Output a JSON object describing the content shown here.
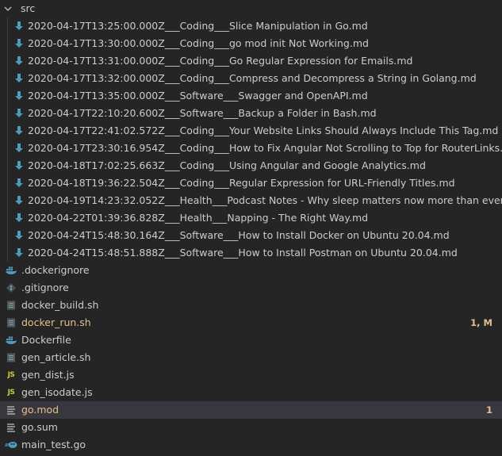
{
  "explorer": {
    "folder": {
      "name": "src",
      "expanded": true,
      "icon": "chevron-down-icon",
      "files": [
        {
          "name": "2020-04-17T13:25:00.000Z___Coding___Slice Manipulation in Go.md",
          "icon": "markdown-download-icon"
        },
        {
          "name": "2020-04-17T13:30:00.000Z___Coding___go mod init Not Working.md",
          "icon": "markdown-download-icon"
        },
        {
          "name": "2020-04-17T13:31:00.000Z___Coding___Go Regular Expression for Emails.md",
          "icon": "markdown-download-icon"
        },
        {
          "name": "2020-04-17T13:32:00.000Z___Coding___Compress and Decompress a String in Golang.md",
          "icon": "markdown-download-icon"
        },
        {
          "name": "2020-04-17T13:35:00.000Z___Software___Swagger and OpenAPI.md",
          "icon": "markdown-download-icon"
        },
        {
          "name": "2020-04-17T22:10:20.600Z___Software___Backup a Folder in Bash.md",
          "icon": "markdown-download-icon"
        },
        {
          "name": "2020-04-17T22:41:02.572Z___Coding___Your Website Links Should Always Include This Tag.md",
          "icon": "markdown-download-icon"
        },
        {
          "name": "2020-04-17T23:30:16.954Z___Coding___How to Fix Angular Not Scrolling to Top for RouterLinks.md",
          "icon": "markdown-download-icon"
        },
        {
          "name": "2020-04-18T17:02:25.663Z___Coding___Using Angular and Google Analytics.md",
          "icon": "markdown-download-icon"
        },
        {
          "name": "2020-04-18T19:36:22.504Z___Coding___Regular Expression for URL-Friendly Titles.md",
          "icon": "markdown-download-icon"
        },
        {
          "name": "2020-04-19T14:23:32.052Z___Health___Podcast Notes - Why sleep matters now more than ever.md",
          "icon": "markdown-download-icon"
        },
        {
          "name": "2020-04-22T01:39:36.828Z___Health___Napping - The Right Way.md",
          "icon": "markdown-download-icon"
        },
        {
          "name": "2020-04-24T15:48:30.164Z___Software___How to Install Docker on Ubuntu 20.04.md",
          "icon": "markdown-download-icon"
        },
        {
          "name": "2020-04-24T15:48:51.888Z___Software___How to Install Postman on Ubuntu 20.04.md",
          "icon": "markdown-download-icon"
        }
      ]
    },
    "root_files": [
      {
        "name": ".dockerignore",
        "icon": "docker-icon",
        "badge": "",
        "modified": false,
        "selected": false
      },
      {
        "name": ".gitignore",
        "icon": "git-icon",
        "badge": "",
        "modified": false,
        "selected": false
      },
      {
        "name": "docker_build.sh",
        "icon": "shell-script-icon",
        "badge": "",
        "modified": false,
        "selected": false
      },
      {
        "name": "docker_run.sh",
        "icon": "shell-script-icon",
        "badge": "1, M",
        "modified": true,
        "selected": false
      },
      {
        "name": "Dockerfile",
        "icon": "docker-icon",
        "badge": "",
        "modified": false,
        "selected": false
      },
      {
        "name": "gen_article.sh",
        "icon": "shell-script-icon",
        "badge": "",
        "modified": false,
        "selected": false
      },
      {
        "name": "gen_dist.js",
        "icon": "javascript-icon",
        "badge": "",
        "modified": false,
        "selected": false
      },
      {
        "name": "gen_isodate.js",
        "icon": "javascript-icon",
        "badge": "",
        "modified": false,
        "selected": false
      },
      {
        "name": "go.mod",
        "icon": "text-lines-icon",
        "badge": "1",
        "modified": true,
        "selected": true
      },
      {
        "name": "go.sum",
        "icon": "text-lines-icon",
        "badge": "",
        "modified": false,
        "selected": false
      },
      {
        "name": "main_test.go",
        "icon": "go-gopher-icon",
        "badge": "",
        "modified": false,
        "selected": false
      }
    ],
    "colors": {
      "background": "#252526",
      "text": "#cccccc",
      "modified": "#e2c08d",
      "selected_row": "#37373d",
      "markdown_icon": "#519aba",
      "docker_icon": "#519aba",
      "shell_icon": "#8d9aa3",
      "js_icon": "#cbcb41",
      "go_icon": "#519aba"
    }
  }
}
